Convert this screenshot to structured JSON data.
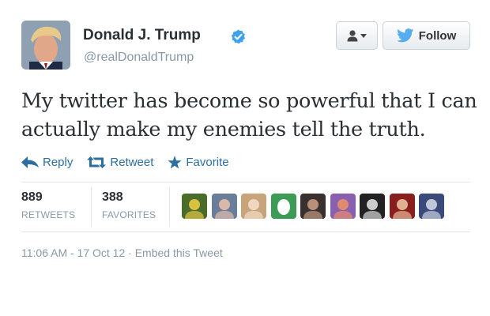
{
  "author": {
    "name": "Donald J. Trump",
    "handle": "@realDonaldTrump",
    "verified": true,
    "verified_color": "#3ea1ec"
  },
  "header_buttons": {
    "user_actions_icon": "user-icon",
    "follow_label": "Follow"
  },
  "tweet": {
    "text": "My twitter has become so powerful that I can actually make my enemies tell the truth."
  },
  "actions": [
    {
      "label": "Reply",
      "icon": "reply-icon"
    },
    {
      "label": "Retweet",
      "icon": "retweet-icon"
    },
    {
      "label": "Favorite",
      "icon": "star-icon"
    }
  ],
  "stats": {
    "retweets": {
      "count": "889",
      "label": "RETWEETS"
    },
    "favorites": {
      "count": "388",
      "label": "FAVORITES"
    }
  },
  "favoriters": [
    {
      "bg": "#4a6b2a",
      "fg": "#d8c040"
    },
    {
      "bg": "#6a7d9a",
      "fg": "#d9b8a8"
    },
    {
      "bg": "#c8a47a",
      "fg": "#f0d8c0"
    },
    {
      "bg": "#3c9c56",
      "fg": "#ffffff"
    },
    {
      "bg": "#3a3030",
      "fg": "#b89078"
    },
    {
      "bg": "#8a5fb0",
      "fg": "#e08a70"
    },
    {
      "bg": "#222222",
      "fg": "#cccccc"
    },
    {
      "bg": "#8a1d1d",
      "fg": "#e0b090"
    },
    {
      "bg": "#3a4a7a",
      "fg": "#c0c8d8"
    }
  ],
  "meta": {
    "timestamp": "11:06 AM - 17 Oct 12",
    "separator": "·",
    "embed_label": "Embed this Tweet"
  },
  "colors": {
    "link": "#2b6ea0",
    "muted": "#8899a6",
    "text": "#292f33",
    "twitter_blue": "#55acee"
  }
}
